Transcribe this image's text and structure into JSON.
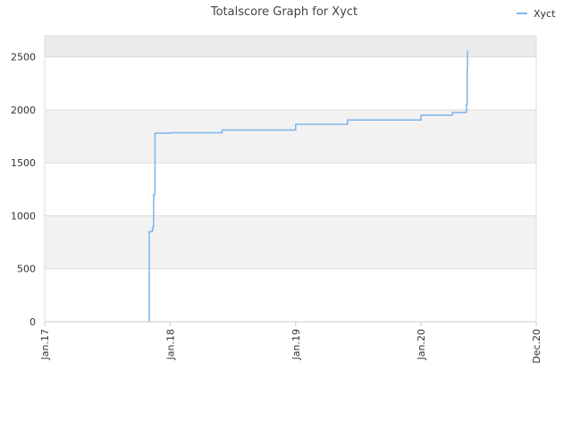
{
  "chart_data": {
    "type": "line",
    "title": "Totalscore Graph for Xyct",
    "legend": {
      "position": "top-right"
    },
    "grid": true,
    "colors": {
      "series": "#7cb5ec",
      "band_odd": "#f2f2f2",
      "band_top": "#ebebeb",
      "grid": "#dddddd",
      "axis": "#cccccc",
      "text": "#333333"
    },
    "x_axis": {
      "type": "date",
      "min": "2017-01-01",
      "max": "2020-12-01",
      "ticks": [
        {
          "label": "Jan.17",
          "date": "2017-01-01"
        },
        {
          "label": "Jan.18",
          "date": "2018-01-01"
        },
        {
          "label": "Jan.19",
          "date": "2019-01-01"
        },
        {
          "label": "Jan.20",
          "date": "2020-01-01"
        },
        {
          "label": "Dec.20",
          "date": "2020-12-01"
        }
      ]
    },
    "y_axis": {
      "min": 0,
      "max": 2700,
      "ticks": [
        0,
        500,
        1000,
        1500,
        2000,
        2500
      ]
    },
    "series": [
      {
        "name": "Xyct",
        "points": [
          [
            "2017-11-01",
            0
          ],
          [
            "2017-11-01",
            850
          ],
          [
            "2017-11-10",
            870
          ],
          [
            "2017-11-12",
            900
          ],
          [
            "2017-11-14",
            1200
          ],
          [
            "2017-11-18",
            1780
          ],
          [
            "2018-01-01",
            1785
          ],
          [
            "2018-06-01",
            1810
          ],
          [
            "2019-01-01",
            1865
          ],
          [
            "2019-06-01",
            1905
          ],
          [
            "2020-01-01",
            1950
          ],
          [
            "2020-04-01",
            1975
          ],
          [
            "2020-05-10",
            1980
          ],
          [
            "2020-05-12",
            2050
          ],
          [
            "2020-05-14",
            2380
          ],
          [
            "2020-05-15",
            2560
          ]
        ]
      }
    ]
  }
}
